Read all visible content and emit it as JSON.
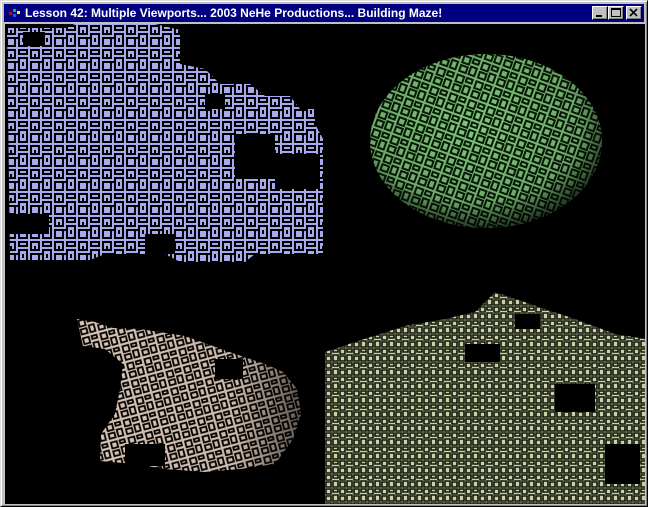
{
  "window": {
    "title": "Lesson 42: Multiple Viewports... 2003 NeHe Productions... Building Maze!",
    "icon": "opengl-app-icon",
    "buttons": {
      "minimize": "minimize-icon",
      "maximize": "maximize-icon",
      "close": "close-icon"
    }
  },
  "viewports": [
    {
      "name": "flat-maze-view",
      "color": "#a7a9ee"
    },
    {
      "name": "sphere-maze-view",
      "color": "#7fc87a"
    },
    {
      "name": "cylinder-maze-view",
      "color": "#f0d9c8"
    },
    {
      "name": "perspective-plane-maze-view",
      "color": "#c8d2a8"
    }
  ]
}
